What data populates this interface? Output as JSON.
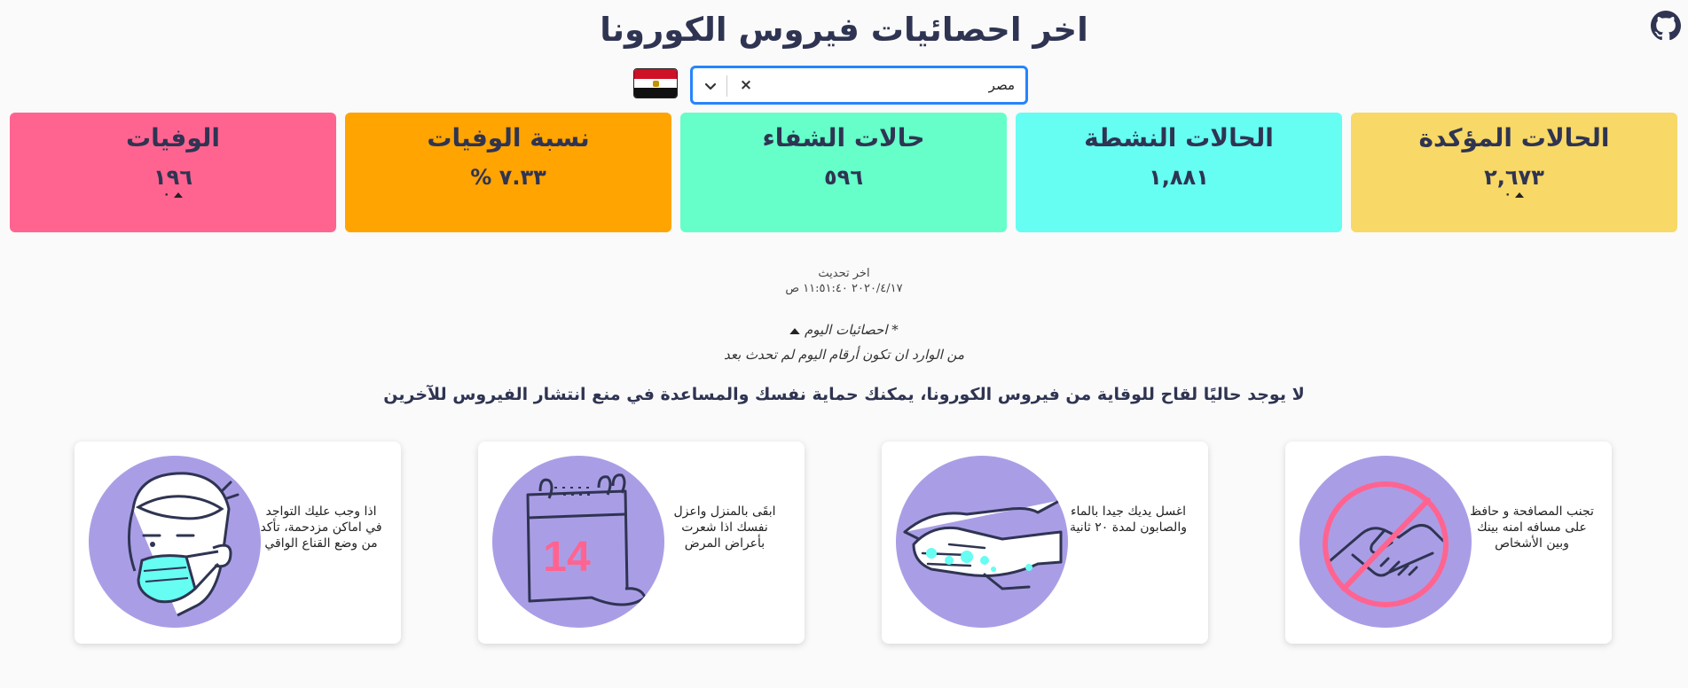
{
  "header": {
    "title": "اخر احصائيات فيروس الكورونا"
  },
  "country_select": {
    "value": "مصر",
    "clear_glyph": "×"
  },
  "flag": {
    "country": "Egypt",
    "colors": [
      "#ce1126",
      "#ffffff",
      "#111111"
    ]
  },
  "stats": [
    {
      "label": "الحالات المؤكدة",
      "value": "٢,٦٧٣",
      "delta": "٠",
      "color": "#f8d866"
    },
    {
      "label": "الحالات النشطة",
      "value": "١,٨٨١",
      "delta": "",
      "color": "#66fdf3"
    },
    {
      "label": "حالات الشفاء",
      "value": "٥٩٦",
      "delta": "",
      "color": "#66ffc9"
    },
    {
      "label": "نسبة الوفيات",
      "value": "٧.٣٣ %",
      "delta": "",
      "color": "#ffa400"
    },
    {
      "label": "الوفيات",
      "value": "١٩٦",
      "delta": "٠",
      "color": "#ff6491"
    }
  ],
  "updated": {
    "label": "اخر تحديث",
    "datetime": "٢٠٢٠/٤/١٧ ١١:٥١:٤٠ ص"
  },
  "note": {
    "line1": "* احصائيات اليوم",
    "line2": "من الوارد ان تكون أرقام اليوم لم تحدث بعد"
  },
  "headline": "لا يوجد حاليًا لقاح للوقاية من فيروس الكورونا، يمكنك حماية نفسك والمساعدة في منع انتشار الفيروس للآخرين",
  "tips": [
    {
      "text": "تجنب المصافحة و حافظ على مسافه امنه بينك وبين الأشخاص",
      "icon": "no-handshake-icon"
    },
    {
      "text": "اغسل يديك جيدا بالماء والصابون لمدة ٢٠ ثانية",
      "icon": "hand-washing-icon"
    },
    {
      "text": "ابقَى بالمنزل واعزل نفسك اذا شعرت بأعراض المرض",
      "icon": "calendar-14-icon",
      "calendar_number": "14"
    },
    {
      "text": "اذا وجب عليك التواجد في اماكن مزدحمة، تأكد من وضع القناع الواقي",
      "icon": "face-mask-icon"
    }
  ]
}
